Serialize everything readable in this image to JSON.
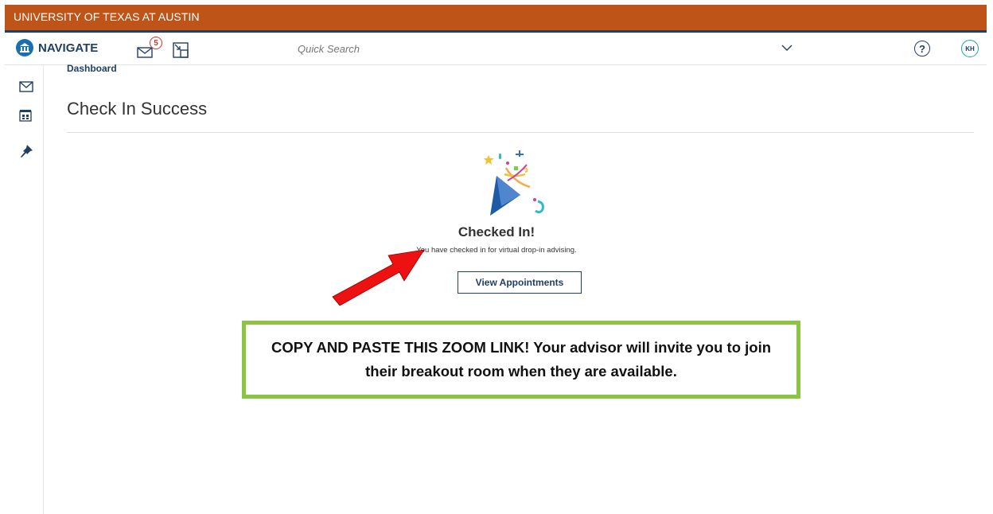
{
  "univ_bar": {
    "title": "UNIVERSITY OF TEXAS AT AUSTIN"
  },
  "nav": {
    "brand": "NAVIGATE",
    "mail_badge": "5",
    "search_placeholder": "Quick Search",
    "avatar_initials": "KH",
    "help_glyph": "?"
  },
  "sidebar": {
    "items": [
      "mail-icon",
      "calendar-icon",
      "pin-icon"
    ]
  },
  "breadcrumb": "Dashboard",
  "page_title": "Check In Success",
  "status": {
    "title": "Checked In!",
    "message": "You have checked in for virtual drop-in advising.",
    "button": "View Appointments"
  },
  "callout": {
    "text": "COPY AND PASTE THIS ZOOM LINK! Your advisor will invite you to join their breakout room when they are available."
  },
  "colors": {
    "brand_orange": "#bf5418",
    "navy": "#1f3f67",
    "callout_border": "#8ac541",
    "arrow_red": "#ee1111"
  }
}
